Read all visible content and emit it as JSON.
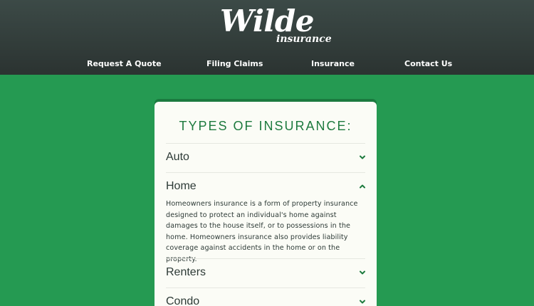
{
  "brand": {
    "logo_main": "Wilde",
    "logo_sub": "insurance"
  },
  "nav": {
    "items": [
      {
        "label": "Request A Quote"
      },
      {
        "label": "Filing Claims"
      },
      {
        "label": "Insurance"
      },
      {
        "label": "Contact Us"
      }
    ]
  },
  "main": {
    "title": "TYPES OF INSURANCE:",
    "accordion": [
      {
        "label": "Auto",
        "expanded": false,
        "icon": "chevron-down-icon"
      },
      {
        "label": "Home",
        "expanded": true,
        "icon": "chevron-up-icon",
        "body": "Homeowners insurance is a form of property insurance designed to protect an individual's home against damages to the house itself, or to possessions in the home. Homeowners insurance also provides liability coverage against accidents in the home or on the property."
      },
      {
        "label": "Renters",
        "expanded": false,
        "icon": "chevron-down-icon"
      },
      {
        "label": "Condo",
        "expanded": false,
        "icon": "chevron-down-icon"
      }
    ]
  },
  "colors": {
    "header_dark": "#2b3331",
    "background_green": "#259a52",
    "accent_green": "#1d7a3e",
    "card_bg": "#fbfcf6"
  }
}
